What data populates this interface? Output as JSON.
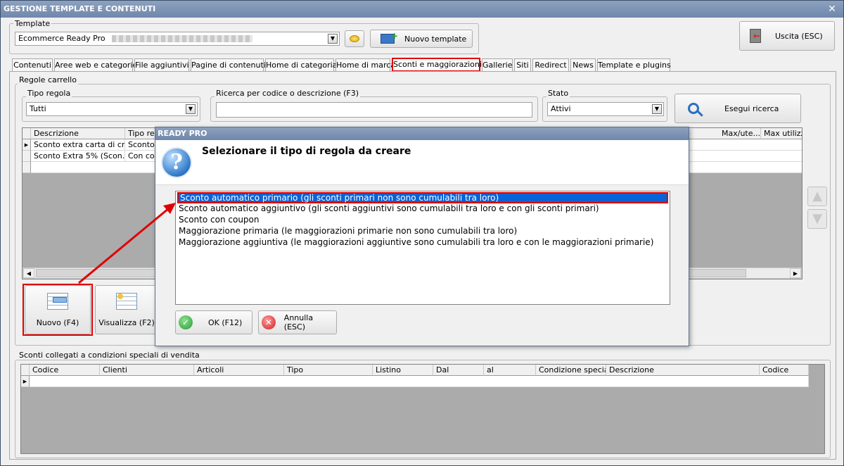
{
  "window": {
    "title": "GESTIONE TEMPLATE E CONTENUTI",
    "close_glyph": "✕"
  },
  "template_group": {
    "label": "Template",
    "selected": "Ecommerce Ready Pro",
    "new_button": "Nuovo template"
  },
  "exit_button": "Uscita (ESC)",
  "tabs": [
    "Contenuti",
    "Aree web e categorie",
    "File aggiuntivi",
    "Pagine di contenuti",
    "Home di categoria",
    "Home di marca",
    "Sconti e maggiorazioni",
    "Gallerie",
    "Siti",
    "Redirect",
    "News",
    "Template e plugins"
  ],
  "active_tab": "Sconti e maggiorazioni",
  "regole": {
    "label": "Regole carrello",
    "tipo_regola_label": "Tipo regola",
    "tipo_regola_value": "Tutti",
    "ricerca_label": "Ricerca per codice o descrizione (F3)",
    "ricerca_value": "",
    "stato_label": "Stato",
    "stato_value": "Attivi",
    "search_button": "Esegui ricerca",
    "columns": [
      "Descrizione",
      "Tipo regola",
      "Max/ute...",
      "Max utilizzi"
    ],
    "rows": [
      {
        "descrizione": "Sconto extra carta di cr...",
        "tipo": "Sconto p"
      },
      {
        "descrizione": "Sconto Extra 5% (Scon...",
        "tipo": "Con cou"
      }
    ],
    "new_button": "Nuovo (F4)",
    "view_button": "Visualizza (F2)"
  },
  "sconti_collegati": {
    "label": "Sconti collegati a condizioni speciali di vendita",
    "columns": [
      "Codice",
      "Clienti",
      "Articoli",
      "Tipo",
      "Listino",
      "Dal",
      "al",
      "Condizione speciale",
      "Descrizione",
      "Codice"
    ]
  },
  "dialog": {
    "title": "READY PRO",
    "message": "Selezionare il tipo di regola da creare",
    "options": [
      "Sconto automatico primario (gli sconti primari non sono cumulabili tra loro)",
      "Sconto automatico aggiuntivo (gli sconti aggiuntivi sono cumulabili tra loro e con gli sconti primari)",
      "Sconto con coupon",
      "Maggiorazione primaria (le maggiorazioni primarie non sono cumulabili tra loro)",
      "Maggiorazione aggiuntiva (le maggiorazioni aggiuntive sono cumulabili tra loro e con le maggiorazioni primarie)"
    ],
    "selected_index": 0,
    "ok_button": "OK (F12)",
    "cancel_button": "Annulla (ESC)"
  },
  "colors": {
    "highlight": "#e00000",
    "selection": "#0a63d6",
    "titlebar": "#7a8fb2"
  }
}
